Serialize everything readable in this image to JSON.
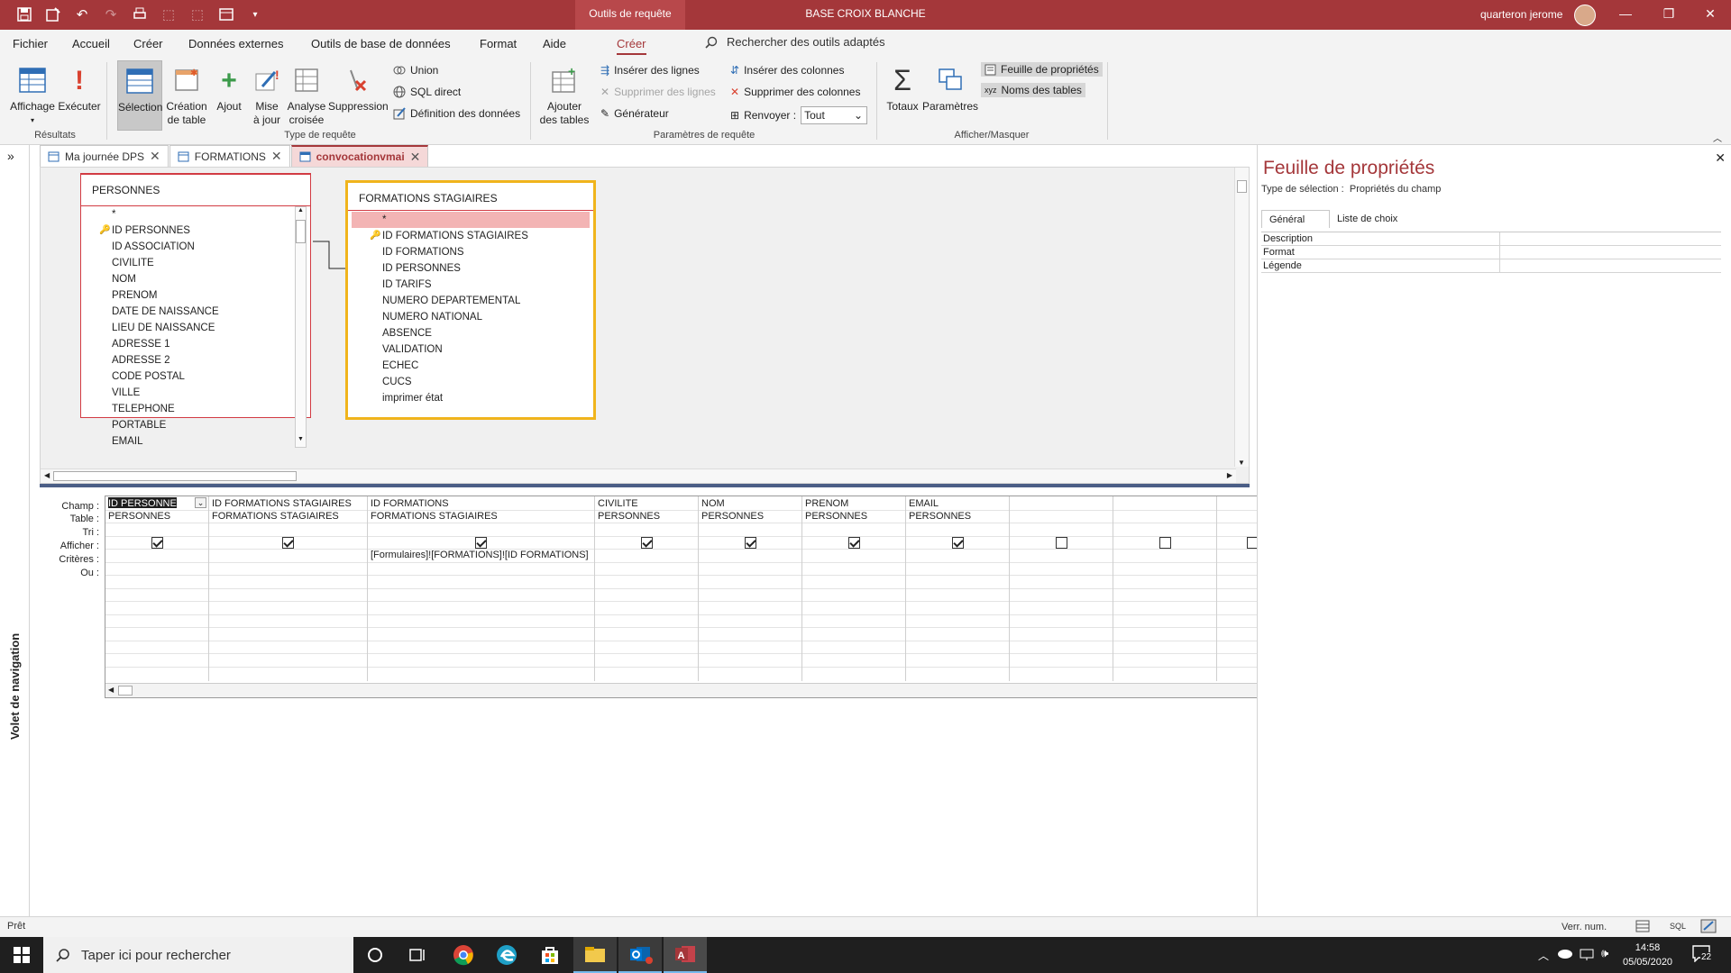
{
  "titlebar": {
    "context_tab": "Outils de requête",
    "title": "BASE CROIX BLANCHE",
    "user": "quarteron jerome",
    "minimize": "—",
    "restore": "❐",
    "close": "✕"
  },
  "menu": {
    "tabs": [
      "Fichier",
      "Accueil",
      "Créer",
      "Données externes",
      "Outils de base de données",
      "Format",
      "Aide",
      "Créer"
    ],
    "tell_me": "Rechercher des outils adaptés"
  },
  "ribbon": {
    "affichage": "Affichage",
    "executer": "Exécuter",
    "selection": "Sélection",
    "creation_table_1": "Création",
    "creation_table_2": "de table",
    "ajout": "Ajout",
    "mise_a_jour_1": "Mise",
    "mise_a_jour_2": "à jour",
    "analyse_1": "Analyse",
    "analyse_2": "croisée",
    "suppression": "Suppression",
    "union": "Union",
    "sql_direct": "SQL direct",
    "definition": "Définition des données",
    "ajouter_tables_1": "Ajouter",
    "ajouter_tables_2": "des tables",
    "inserer_lignes": "Insérer des lignes",
    "supprimer_lignes": "Supprimer des lignes",
    "generateur": "Générateur",
    "inserer_colonnes": "Insérer des colonnes",
    "supprimer_colonnes": "Supprimer des colonnes",
    "renvoyer": "Renvoyer :",
    "renvoyer_value": "Tout",
    "totaux": "Totaux",
    "parametres": "Paramètres",
    "feuille_proprietes": "Feuille de propriétés",
    "noms_tables": "Noms des tables",
    "groups": {
      "resultats": "Résultats",
      "type_requete": "Type de requête",
      "parametres_requete": "Paramètres de requête",
      "afficher_masquer": "Afficher/Masquer"
    }
  },
  "nav": {
    "label": "Volet de navigation",
    "toggle": "»"
  },
  "doc_tabs": [
    {
      "label": "Ma journée DPS"
    },
    {
      "label": "FORMATIONS"
    },
    {
      "label": "convocationvmai"
    }
  ],
  "tables": {
    "personnes": {
      "title": "PERSONNES",
      "fields": [
        "*",
        "ID PERSONNES",
        "ID ASSOCIATION",
        "CIVILITE",
        "NOM",
        "PRENOM",
        "DATE DE NAISSANCE",
        "LIEU DE NAISSANCE",
        "ADRESSE 1",
        "ADRESSE 2",
        "CODE POSTAL",
        "VILLE",
        "TELEPHONE",
        "PORTABLE",
        "EMAIL"
      ]
    },
    "formations_stagiaires": {
      "title": "FORMATIONS STAGIAIRES",
      "fields": [
        "*",
        "ID FORMATIONS STAGIAIRES",
        "ID FORMATIONS",
        "ID PERSONNES",
        "ID TARIFS",
        "NUMERO DEPARTEMENTAL",
        "NUMERO NATIONAL",
        "ABSENCE",
        "VALIDATION",
        "ECHEC",
        "CUCS",
        "imprimer état"
      ]
    }
  },
  "grid": {
    "row_labels": {
      "champ": "Champ :",
      "table": "Table :",
      "tri": "Tri :",
      "afficher": "Afficher :",
      "criteres": "Critères :",
      "ou": "Ou :"
    },
    "columns": [
      {
        "field": "ID PERSONNES",
        "table": "PERSONNES",
        "show": true,
        "criteria": ""
      },
      {
        "field": "ID FORMATIONS STAGIAIRES",
        "table": "FORMATIONS STAGIAIRES",
        "show": true,
        "criteria": ""
      },
      {
        "field": "ID FORMATIONS",
        "table": "FORMATIONS STAGIAIRES",
        "show": true,
        "criteria": "[Formulaires]![FORMATIONS]![ID FORMATIONS]"
      },
      {
        "field": "CIVILITE",
        "table": "PERSONNES",
        "show": true,
        "criteria": ""
      },
      {
        "field": "NOM",
        "table": "PERSONNES",
        "show": true,
        "criteria": ""
      },
      {
        "field": "PRENOM",
        "table": "PERSONNES",
        "show": true,
        "criteria": ""
      },
      {
        "field": "EMAIL",
        "table": "PERSONNES",
        "show": true,
        "criteria": ""
      },
      {
        "field": "",
        "table": "",
        "show": false,
        "criteria": ""
      },
      {
        "field": "",
        "table": "",
        "show": false,
        "criteria": ""
      },
      {
        "field": "",
        "table": "",
        "show": false,
        "criteria": ""
      }
    ]
  },
  "property_sheet": {
    "title": "Feuille de propriétés",
    "selection_label": "Type de sélection :",
    "selection_value": "Propriétés du champ",
    "tabs": [
      "Général",
      "Liste de choix"
    ],
    "rows": [
      {
        "label": "Description",
        "value": ""
      },
      {
        "label": "Format",
        "value": ""
      },
      {
        "label": "Légende",
        "value": ""
      }
    ]
  },
  "status": {
    "left": "Prêt",
    "num": "Verr. num.",
    "sql": "SQL"
  },
  "taskbar": {
    "search_placeholder": "Taper ici pour rechercher",
    "time": "14:58",
    "date": "05/05/2020",
    "notifications": "22"
  },
  "colors": {
    "accent": "#a4373a",
    "table_highlight": "#f3b4b4",
    "selected_table_border": "#f0b41c"
  }
}
